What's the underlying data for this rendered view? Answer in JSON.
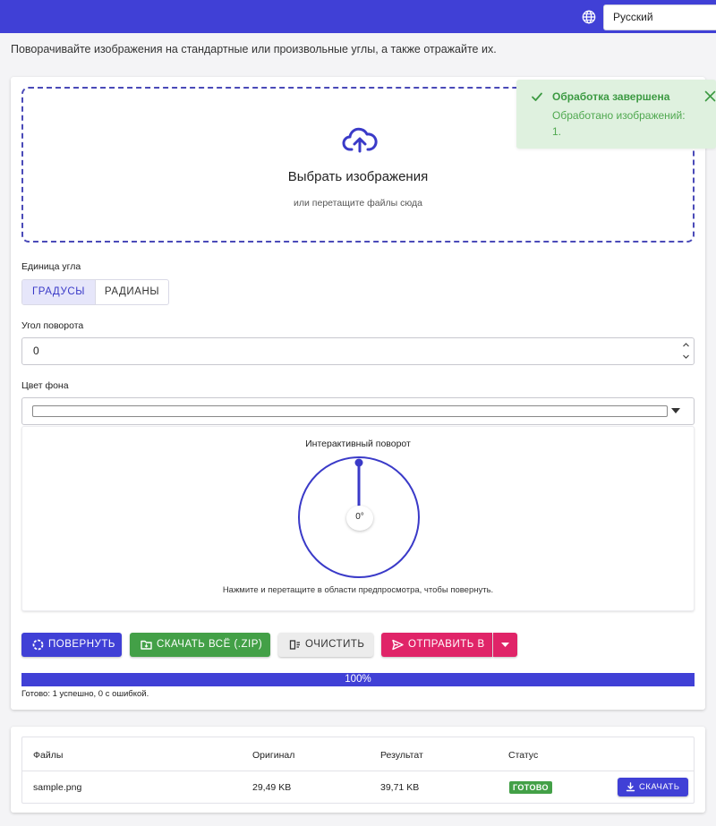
{
  "header": {
    "language": "Русский",
    "subtitle": "Поворачивайте изображения на стандартные или произвольные углы, а также отражайте их."
  },
  "dropzone": {
    "title": "Выбрать изображения",
    "subtitle": "или перетащите файлы сюда"
  },
  "toast": {
    "title": "Обработка завершена",
    "message": "Обработано изображений: 1."
  },
  "angle_unit": {
    "label": "Единица угла",
    "options": [
      "ГРАДУСЫ",
      "РАДИАНЫ"
    ],
    "selected": "ГРАДУСЫ"
  },
  "rotation": {
    "label": "Угол поворота",
    "value": "0"
  },
  "background": {
    "label": "Цвет фона",
    "color": "#ffffff"
  },
  "interactive": {
    "title": "Интерактивный поворот",
    "value_display": "0°",
    "angle_degrees": 0,
    "hint": "Нажмите и перетащите в области предпросмотра, чтобы повернуть."
  },
  "actions": {
    "rotate": "ПОВЕРНУТЬ",
    "download_zip": "СКАЧАТЬ ВСЁ (.ZIP)",
    "clear": "ОЧИСТИТЬ",
    "send": "ОТПРАВИТЬ В"
  },
  "progress": {
    "percent": 100,
    "label": "100%",
    "status": "Готово: 1 успешно, 0 с ошибкой."
  },
  "table": {
    "headers": [
      "Файлы",
      "Оригинал",
      "Результат",
      "Статус"
    ],
    "rows": [
      {
        "file": "sample.png",
        "original": "29,49 KB",
        "result": "39,71 KB",
        "status": "ГОТОВО",
        "action": "СКАЧАТЬ"
      }
    ]
  },
  "colors": {
    "primary": "#4040d6",
    "success": "#43a047",
    "accent": "#e02468",
    "toast_bg": "#dff1df"
  }
}
